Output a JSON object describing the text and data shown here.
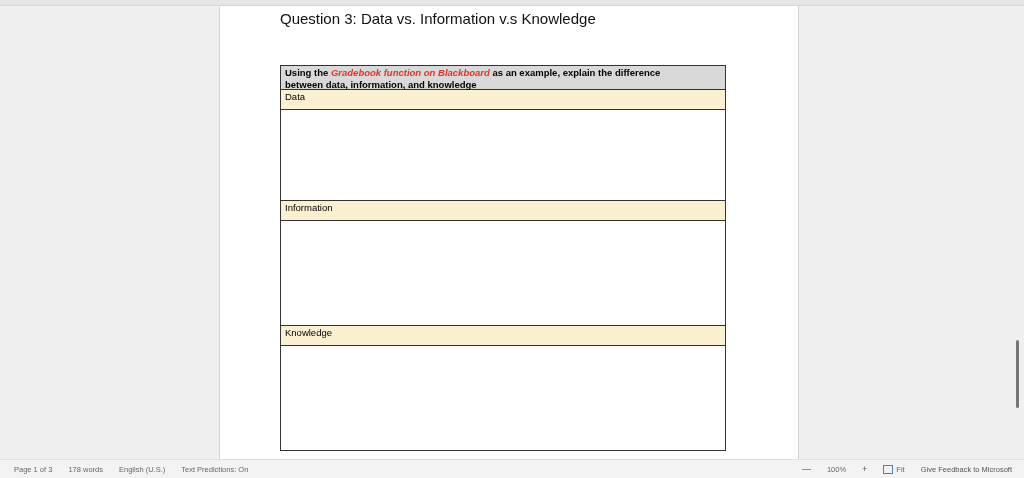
{
  "document": {
    "title": "Question 3: Data vs. Information v.s Knowledge",
    "table": {
      "header": "Using the *Gradebook function on Blackboard* as an example, explain the difference between data, information, and knowledge",
      "sections": [
        {
          "label": "Data"
        },
        {
          "label": "Information"
        },
        {
          "label": "Knowledge"
        }
      ]
    }
  },
  "status_bar": {
    "left": [
      "Page 1 of 3",
      "178 words",
      "English (U.S.)",
      "Text Predictions: On"
    ],
    "zoom_out": "—",
    "zoom": "100%",
    "zoom_in": "+",
    "fit": "Fit",
    "feedback": "Give Feedback to Microsoft"
  }
}
